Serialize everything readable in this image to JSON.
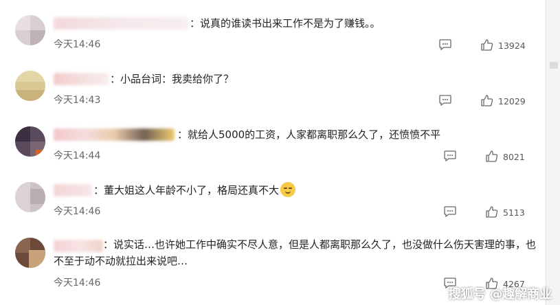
{
  "comments": [
    {
      "text": "：说真的谁读书出来工作不是为了赚钱。。",
      "time": "今天14:46",
      "likes": "13924"
    },
    {
      "text": "：小品台词：我卖给你了？",
      "time": "今天14:43",
      "likes": "12029"
    },
    {
      "text": "：就给人5000的工资，人家都离职那么久了，还愤愤不平",
      "time": "今天14:44",
      "likes": "8021"
    },
    {
      "text": "：董大姐这人年龄不小了，格局还真不大",
      "time": "今天14:46",
      "likes": "5113"
    },
    {
      "text": "：说实话…也许她工作中确实不尽人意，但是人都离职那么久了，也没做什么伤天害理的事，也不至于动不动就拉出来说吧…",
      "time": "今天14:46",
      "likes": "4267"
    }
  ],
  "icons": {
    "reply": "reply-icon",
    "like": "thumbs-up-icon",
    "emoji": "smirk-emoji-icon"
  },
  "watermark": "搜狐号 @趣解商业"
}
